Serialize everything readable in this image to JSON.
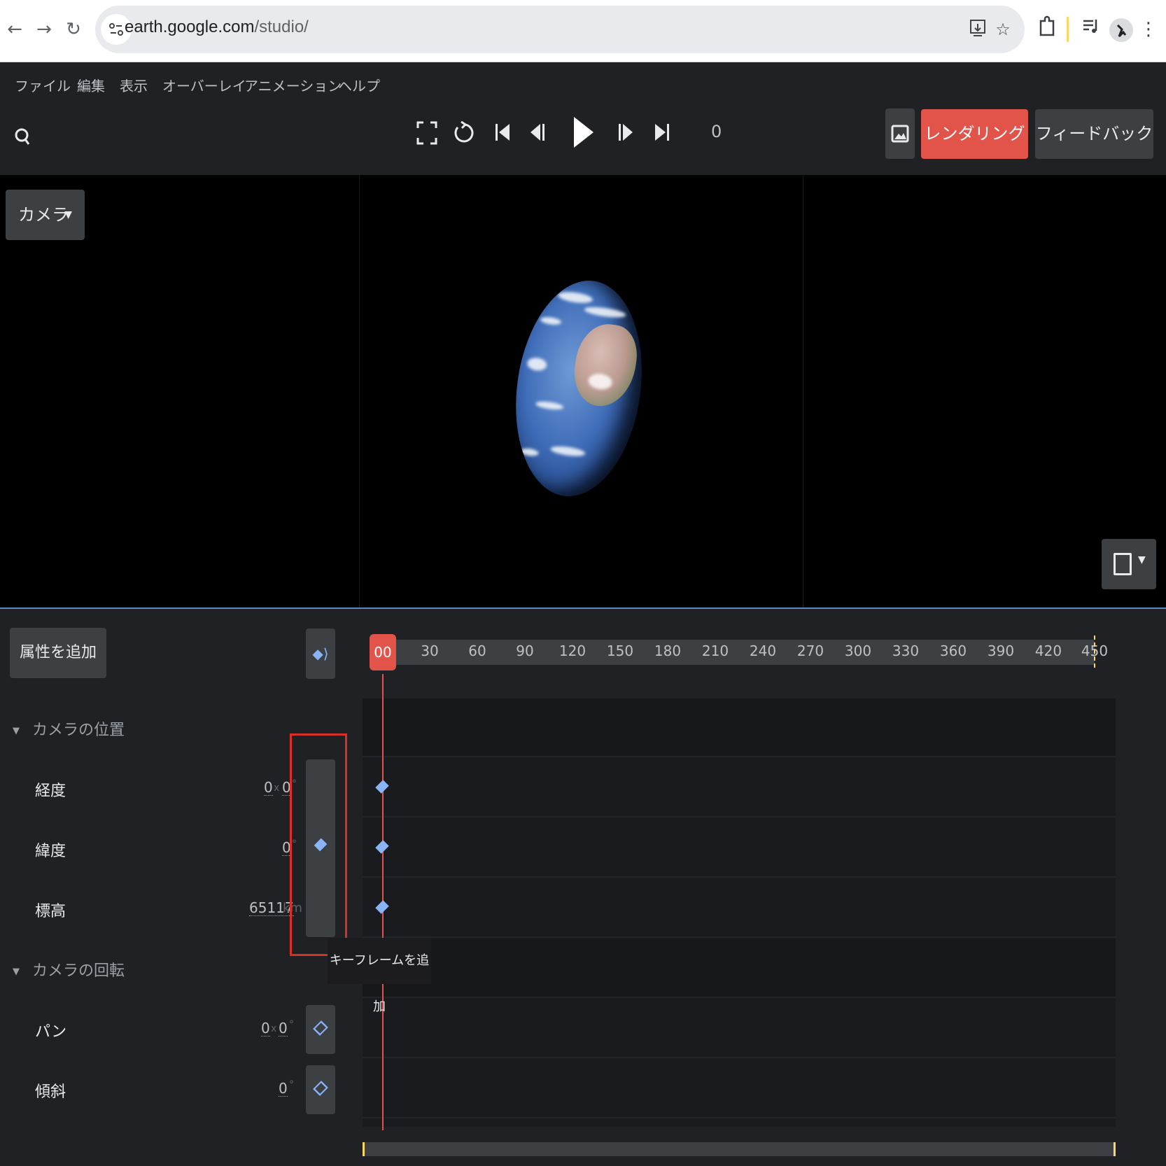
{
  "browser": {
    "url_domain": "earth.google.com",
    "url_path": "/studio/"
  },
  "menu": [
    "ファイル",
    "編集",
    "表示",
    "オーバーレイ",
    "アニメーション",
    "ヘルプ"
  ],
  "toolbar": {
    "frame": "0",
    "render_label": "レンダリング",
    "feedback_label": "フィードバック"
  },
  "viewport": {
    "camera_dropdown": "カメラ"
  },
  "timeline": {
    "add_attribute_label": "属性を追加",
    "current_frame_label": "00",
    "ticks": [
      "30",
      "60",
      "90",
      "120",
      "150",
      "180",
      "210",
      "240",
      "270",
      "300",
      "330",
      "360",
      "390",
      "420",
      "450"
    ]
  },
  "groups": {
    "camera_position": "カメラの位置",
    "camera_rotation": "カメラの回転"
  },
  "properties": {
    "longitude": {
      "label": "経度",
      "value_a": "0",
      "sep": "x",
      "value_b": "0",
      "unit": "°"
    },
    "latitude": {
      "label": "緯度",
      "value": "0",
      "unit": "°"
    },
    "altitude": {
      "label": "標高",
      "value": "65117",
      "unit": "km"
    },
    "pan": {
      "label": "パン",
      "value_a": "0",
      "sep": "x",
      "value_b": "0",
      "unit": "°"
    },
    "tilt": {
      "label": "傾斜",
      "value": "0",
      "unit": "°"
    }
  },
  "tooltip": "キーフレームを追加",
  "colors": {
    "accent_red": "#e2544a",
    "keyframe_blue": "#8ab4f8",
    "end_marker": "#fdd663",
    "highlight_red": "#d93025"
  }
}
